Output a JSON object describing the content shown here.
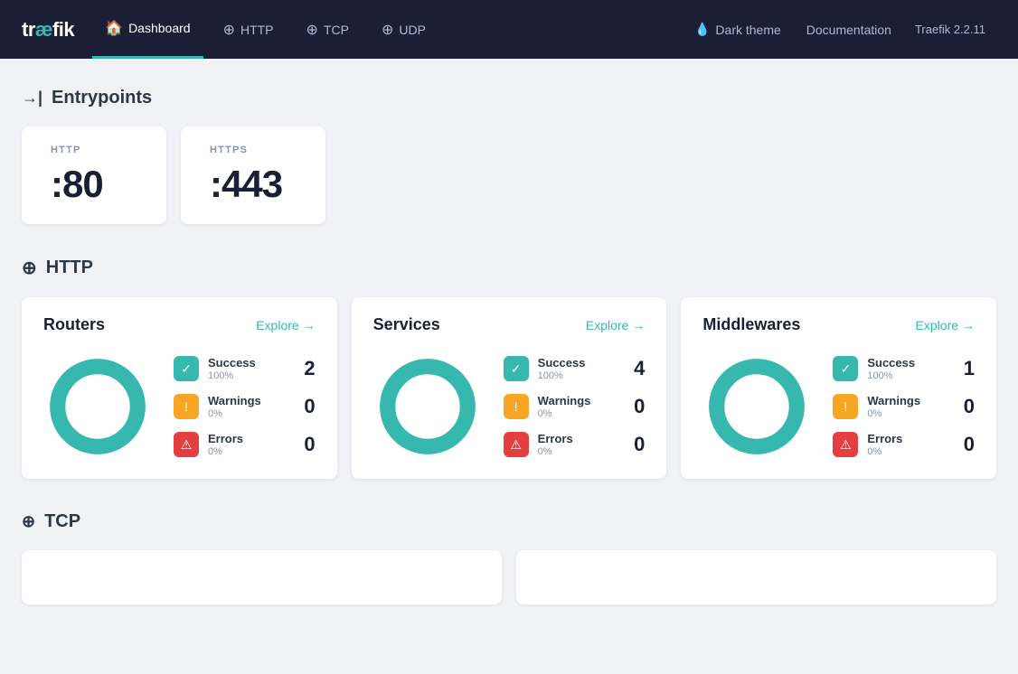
{
  "nav": {
    "logo": "træfik",
    "logo_accent": "æ",
    "items": [
      {
        "id": "dashboard",
        "label": "Dashboard",
        "icon": "🏠",
        "active": true
      },
      {
        "id": "http",
        "label": "HTTP",
        "icon": "⊕"
      },
      {
        "id": "tcp",
        "label": "TCP",
        "icon": "⊕"
      },
      {
        "id": "udp",
        "label": "UDP",
        "icon": "⊕"
      }
    ],
    "dark_theme_label": "Dark theme",
    "dark_theme_icon": "💧",
    "documentation_label": "Documentation",
    "version": "Traefik 2.2.11"
  },
  "entrypoints": {
    "section_label": "Entrypoints",
    "items": [
      {
        "id": "http",
        "label": "HTTP",
        "value": ":80"
      },
      {
        "id": "https",
        "label": "HTTPS",
        "value": ":443"
      }
    ]
  },
  "http_section": {
    "section_label": "HTTP",
    "cards": [
      {
        "id": "routers",
        "title": "Routers",
        "explore_label": "Explore",
        "stats": [
          {
            "type": "success",
            "label": "Success",
            "pct": "100%",
            "count": 2
          },
          {
            "type": "warning",
            "label": "Warnings",
            "pct": "0%",
            "count": 0
          },
          {
            "type": "error",
            "label": "Errors",
            "pct": "0%",
            "count": 0
          }
        ],
        "donut_success_pct": 100
      },
      {
        "id": "services",
        "title": "Services",
        "explore_label": "Explore",
        "stats": [
          {
            "type": "success",
            "label": "Success",
            "pct": "100%",
            "count": 4
          },
          {
            "type": "warning",
            "label": "Warnings",
            "pct": "0%",
            "count": 0
          },
          {
            "type": "error",
            "label": "Errors",
            "pct": "0%",
            "count": 0
          }
        ],
        "donut_success_pct": 100
      },
      {
        "id": "middlewares",
        "title": "Middlewares",
        "explore_label": "Explore",
        "stats": [
          {
            "type": "success",
            "label": "Success",
            "pct": "100%",
            "count": 1
          },
          {
            "type": "warning",
            "label": "Warnings",
            "pct": "0%",
            "count": 0
          },
          {
            "type": "error",
            "label": "Errors",
            "pct": "0%",
            "count": 0
          }
        ],
        "donut_success_pct": 100
      }
    ]
  },
  "tcp_section": {
    "section_label": "TCP"
  },
  "colors": {
    "teal": "#37b8af",
    "orange": "#f6a623",
    "red": "#e53e3e",
    "navy": "#1a1f36"
  }
}
